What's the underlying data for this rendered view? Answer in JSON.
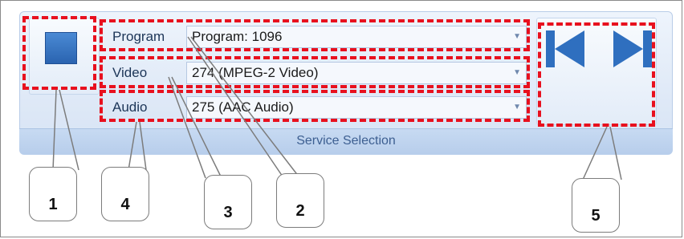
{
  "service_selection": {
    "group_label": "Service Selection",
    "program": {
      "label": "Program",
      "value": "Program: 1096"
    },
    "video": {
      "label": "Video",
      "value": "274 (MPEG-2 Video)"
    },
    "audio": {
      "label": "Audio",
      "value": "275 (AAC Audio)"
    }
  },
  "callouts": [
    "1",
    "2",
    "3",
    "4",
    "5"
  ],
  "colors": {
    "ribbon_blue": "#dfe9f7",
    "icon_blue": "#2a63b0",
    "highlight_red": "#e8101e"
  },
  "icons": {
    "stop": "stop-icon",
    "previous": "skip-previous-icon",
    "next": "skip-next-icon"
  }
}
